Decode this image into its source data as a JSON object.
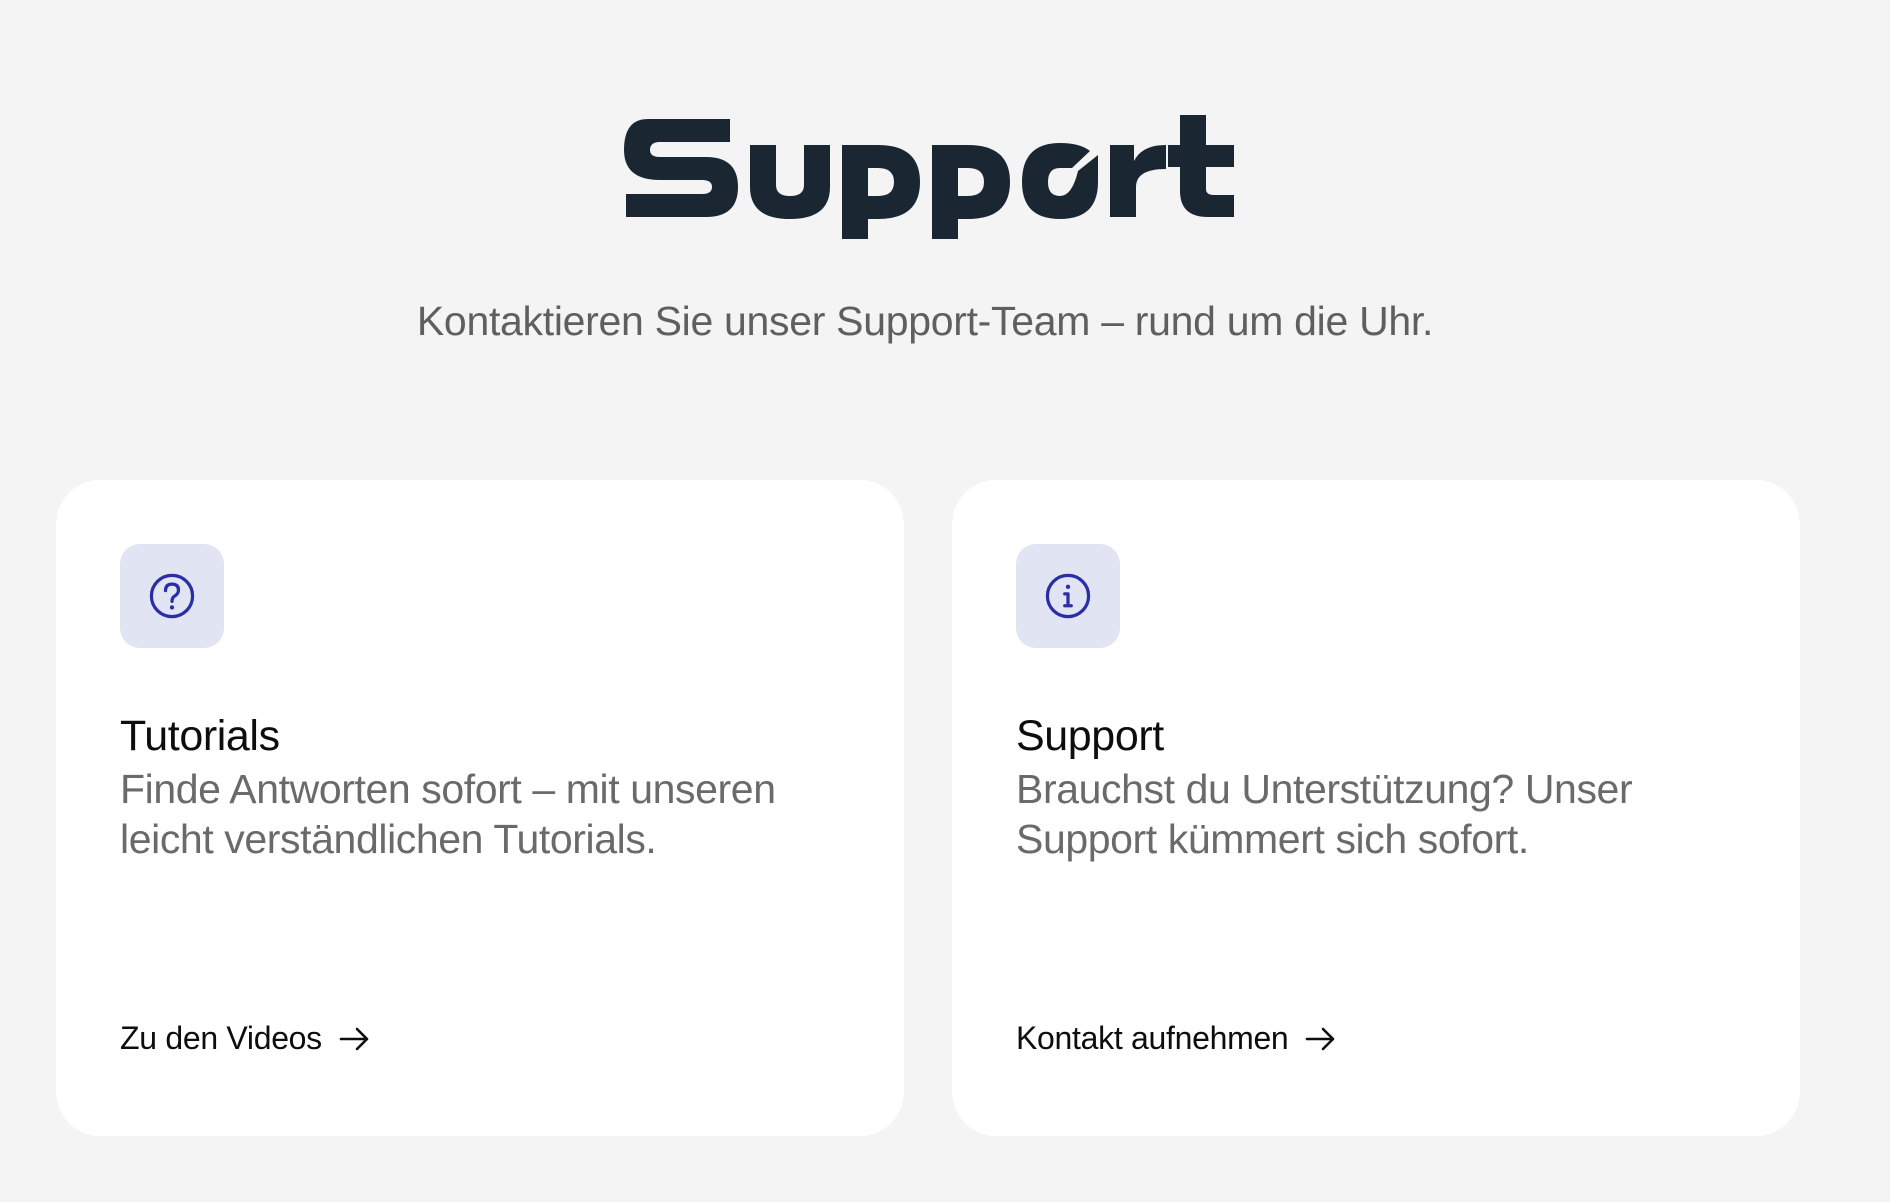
{
  "hero": {
    "logo_text": "Support",
    "subtitle": "Kontaktieren Sie unser Support-Team – rund um die Uhr."
  },
  "cards": [
    {
      "icon": "question-circle-icon",
      "title": "Tutorials",
      "description": "Finde Antworten sofort – mit unseren leicht verständlichen Tutorials.",
      "link_label": "Zu den Videos"
    },
    {
      "icon": "info-circle-icon",
      "title": "Support",
      "description": "Brauchst du Unterstützung? Unser Support kümmert sich sofort.",
      "link_label": "Kontakt aufnehmen"
    }
  ],
  "colors": {
    "background": "#f4f4f4",
    "card": "#ffffff",
    "logo": "#1a2733",
    "icon_bg": "#e1e4f3",
    "icon_stroke": "#2a2fa6"
  }
}
